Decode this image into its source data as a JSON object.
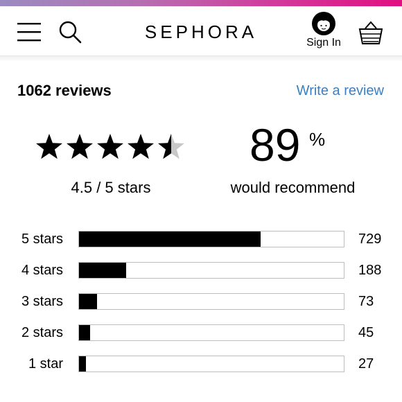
{
  "header": {
    "brand": "SEPHORA",
    "sign_in_label": "Sign In",
    "icons": {
      "menu": "hamburger-menu-icon",
      "search": "search-icon",
      "user": "user-avatar-icon",
      "basket": "basket-icon"
    },
    "gradient_colors": [
      "#9b8bc0",
      "#e0107f"
    ]
  },
  "summary": {
    "reviews_count_text": "1062 reviews",
    "write_review_link": "Write a review",
    "link_color": "#3a7fc1",
    "rating_value": 4.5,
    "rating_max": 5,
    "rating_text": "4.5 / 5 stars",
    "recommend_percent": "89",
    "recommend_suffix": "%",
    "recommend_label": "would recommend"
  },
  "distribution": [
    {
      "label": "5 stars",
      "count": "729",
      "value": 729
    },
    {
      "label": "4 stars",
      "count": "188",
      "value": 188
    },
    {
      "label": "3 stars",
      "count": "73",
      "value": 73
    },
    {
      "label": "2 stars",
      "count": "45",
      "value": 45
    },
    {
      "label": "1 star",
      "count": "27",
      "value": 27
    }
  ],
  "distribution_max": 1062
}
